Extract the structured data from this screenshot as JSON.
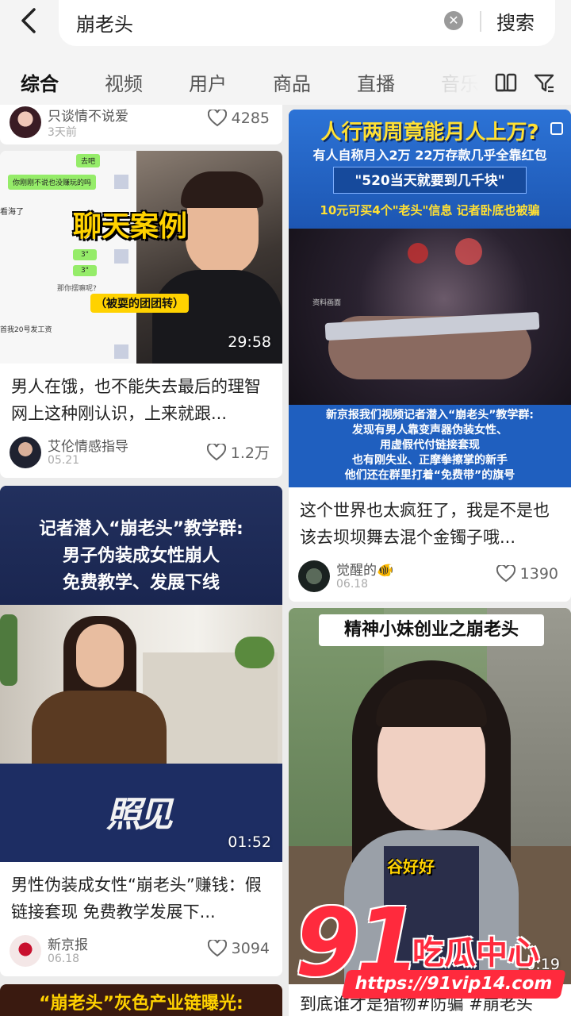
{
  "search": {
    "query": "崩老头",
    "button_label": "搜索"
  },
  "tabs": [
    {
      "label": "综合",
      "active": true
    },
    {
      "label": "视频"
    },
    {
      "label": "用户"
    },
    {
      "label": "商品"
    },
    {
      "label": "直播"
    },
    {
      "label": "音乐"
    }
  ],
  "top_partial": {
    "author": "只谈情不说爱",
    "date": "3天前",
    "likes": "4285"
  },
  "cards": [
    {
      "overlay_title": "聊天案例",
      "overlay_sub": "（被耍的团团转）",
      "chat_lines": [
        "去吧",
        "你刚刚不说也没赚玩的吗",
        "看海了",
        "3\"",
        "3\"",
        "那你摆嘛呢?",
        "首我20号发工资"
      ],
      "duration": "29:58",
      "title": "男人在饿，也不能失去最后的理智 网上这种刚认识，上来就跟...",
      "author": "艾伦情感指导",
      "date": "05.21",
      "likes": "1.2万"
    },
    {
      "overlay_lines": [
        "记者潜入“崩老头”教学群:",
        "男子伪装成女性崩人",
        "免费教学、发展下线"
      ],
      "logo_text": "照见",
      "duration": "01:52",
      "title": "男性伪装成女性“崩老头”赚钱：假链接套现 免费教学发展下...",
      "author": "新京报",
      "date": "06.18",
      "likes": "3094"
    },
    {
      "partial_overlay": "“崩老头”灰色产业链曝光:"
    },
    {
      "headline": "人行两周竟能月人上万?",
      "sub1": "有人自称月入2万 22万存款几乎全靠红包",
      "sub2": "\"520当天就要到几千块\"",
      "sub3": "10元可买4个\"老头\"信息 记者卧底也被骗",
      "bottom_lines": [
        "新京报我们视频记者潜入“崩老头”教学群:",
        "发现有男人靠变声器伪装女性、",
        "用虚假代付链接套现",
        "也有刚失业、正摩拳擦掌的新手",
        "他们还在群里打着“免费带”的旗号"
      ],
      "photo_label": "资料画面",
      "title": "这个世界也太疯狂了，我是不是也该去坝坝舞去混个金镯子哦...",
      "author": "觉醒的🐠",
      "date": "06.18",
      "likes": "1390"
    },
    {
      "overlay_top": "精神小妹创业之崩老头",
      "overlay_mid": "谷好好",
      "duration": "0:19",
      "title": "到底谁才是猎物#防骗 #崩老头"
    }
  ],
  "watermark": {
    "big": "91",
    "cn": "吃瓜中心",
    "url": "https://91vip14.com"
  },
  "colors": {
    "accent": "#ff2a3d",
    "page_bg": "#ececec",
    "news_blue": "#1f5fbf"
  }
}
